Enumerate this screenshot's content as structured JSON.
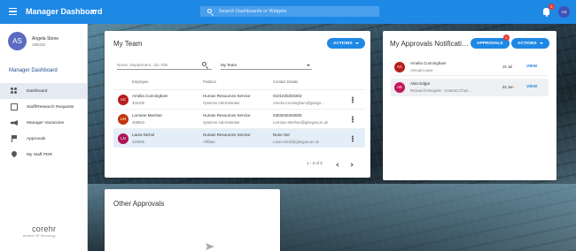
{
  "header": {
    "title": "Manager Dashboard",
    "search_placeholder": "Search Dashboards or Widgets",
    "notification_count": "1",
    "avatar_initials": "AS"
  },
  "user": {
    "initials": "AS",
    "name": "Angela Stone",
    "id": "188433"
  },
  "sidebar": {
    "heading": "Manager Dashboard",
    "items": [
      {
        "label": "Dashboard",
        "icon": "people-icon",
        "active": true
      },
      {
        "label": "Staff/Research Requests",
        "icon": "document-icon"
      },
      {
        "label": "Manager Vacancies",
        "icon": "megaphone-icon"
      },
      {
        "label": "Approvals",
        "icon": "flag-icon"
      },
      {
        "label": "My Staff PDR",
        "icon": "pin-icon"
      }
    ],
    "brand": "corehr",
    "brand_sub": "Breathe HR Technology"
  },
  "my_team": {
    "title": "My Team",
    "actions_label": "ACTIONS",
    "search_placeholder": "Name, Department, Job Title",
    "filter_value": "My Team",
    "columns": [
      "Employee",
      "Position",
      "Contact Details"
    ],
    "rows": [
      {
        "initials": "AC",
        "color": "#b71c1c",
        "name": "Amelia Cunningham",
        "id": "303105",
        "position": "Human Resources Service",
        "role": "Systems Administrator",
        "phone": "0101030203303",
        "email": "Amelia.Cunningham@glasgo…"
      },
      {
        "initials": "LM",
        "color": "#bf360c",
        "name": "Lorraine Meehan",
        "id": "308834",
        "position": "Human Resources Service",
        "role": "Systems Administrator",
        "phone": "0303040403005",
        "email": "Lorraine.Meehan@glasgow.ac.uk"
      },
      {
        "initials": "LN",
        "color": "#ad1457",
        "name": "Laura Nichol",
        "id": "320665",
        "position": "Human Resources Service",
        "role": "Affiliate",
        "phone": "None Set",
        "email": "Laura.Nicol@glasgow.ac.uk"
      }
    ],
    "pager": "1 - 3 of 3"
  },
  "approvals": {
    "title": "My Approvals Notificati…",
    "approvals_label": "APPROVALS",
    "approvals_badge": "2",
    "actions_label": "ACTIONS",
    "items": [
      {
        "initials": "AC",
        "color": "#b71c1c",
        "name": "Amelia Cunningham",
        "type": "Annual Leave",
        "date": "15 Jul",
        "action": "VIEW"
      },
      {
        "initials": "AE",
        "color": "#c2185b",
        "name": "Alan Edgar",
        "type": "Research Request - Contract Chan…",
        "date": "02 Jun",
        "action": "VIEW"
      }
    ]
  },
  "other_approvals": {
    "title": "Other Approvals"
  }
}
